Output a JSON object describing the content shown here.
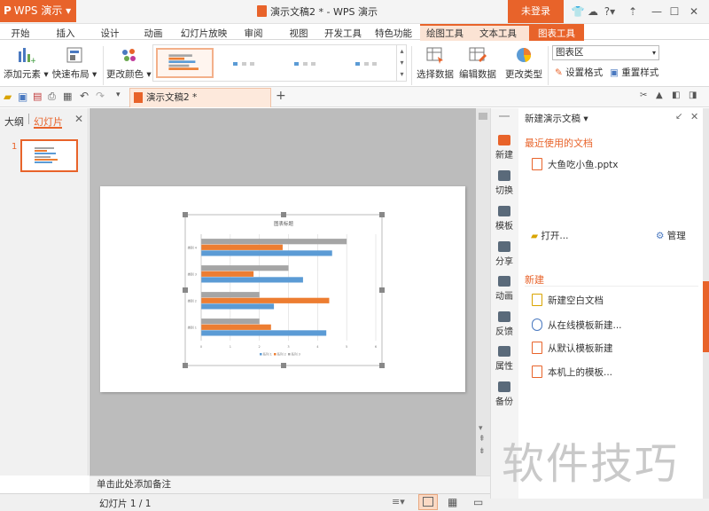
{
  "app": {
    "brand": "WPS 演示",
    "window_title": "演示文稿2 * - WPS 演示",
    "login": "未登录"
  },
  "menu_tabs": [
    "开始",
    "插入",
    "设计",
    "动画",
    "幻灯片放映",
    "审阅",
    "视图",
    "开发工具",
    "特色功能",
    "绘图工具",
    "文本工具",
    "图表工具"
  ],
  "ribbon": {
    "add_element": "添加元素",
    "quick_layout": "快速布局",
    "change_color": "更改颜色",
    "select_data": "选择数据",
    "edit_data": "编辑数据",
    "change_type": "更改类型",
    "chart_area_select": "图表区",
    "set_format": "设置格式",
    "reset_style": "重置样式"
  },
  "doc_tab": "演示文稿2 *",
  "left_panel": {
    "outline_tab": "大纲",
    "slides_tab": "幻灯片",
    "slide_number": "1"
  },
  "chart_data": {
    "type": "bar",
    "title": "图表标题",
    "categories": [
      "类别 1",
      "类别 2",
      "类别 3",
      "类别 4"
    ],
    "series": [
      {
        "name": "系列 1",
        "color": "#5b9bd5",
        "values": [
          4.3,
          2.5,
          3.5,
          4.5
        ]
      },
      {
        "name": "系列 2",
        "color": "#ed7d31",
        "values": [
          2.4,
          4.4,
          1.8,
          2.8
        ]
      },
      {
        "name": "系列 3",
        "color": "#a5a5a5",
        "values": [
          2,
          2,
          3,
          5
        ]
      }
    ],
    "xlim": [
      0,
      6
    ],
    "x_ticks": [
      "0",
      "1",
      "2",
      "3",
      "4",
      "5",
      "6"
    ],
    "legend": "bottom"
  },
  "notes_placeholder": "单击此处添加备注",
  "status": {
    "slide_counter": "幻灯片 1 / 1"
  },
  "right_rail": [
    "新建",
    "切换",
    "模板",
    "分享",
    "动画",
    "反馈",
    "属性",
    "备份"
  ],
  "task_pane": {
    "title": "新建演示文稿",
    "recent_heading": "最近使用的文档",
    "recent_files": [
      "大鱼吃小鱼.pptx"
    ],
    "open_label": "打开...",
    "manage_label": "管理",
    "new_heading": "新建",
    "new_items": [
      "新建空白文档",
      "从在线模板新建...",
      "从默认模板新建",
      "本机上的模板..."
    ]
  },
  "watermark": "软件技巧",
  "colors": {
    "accent": "#e8632a"
  }
}
